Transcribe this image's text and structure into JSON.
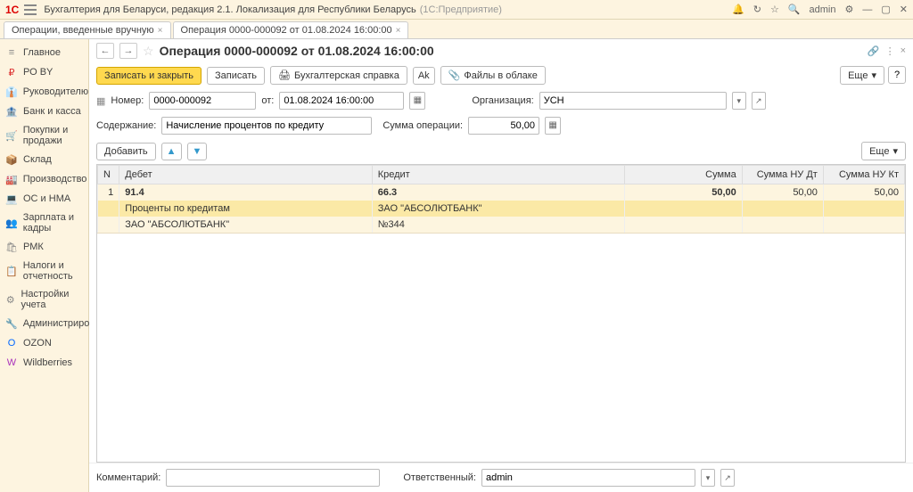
{
  "app": {
    "title": "Бухгалтерия для Беларуси, редакция 2.1. Локализация для Республики Беларусь",
    "sub": "(1С:Предприятие)",
    "user": "admin"
  },
  "tabs": [
    {
      "label": "Операции, введенные вручную"
    },
    {
      "label": "Операция 0000-000092 от 01.08.2024 16:00:00"
    }
  ],
  "nav": [
    {
      "icon": "≡",
      "label": "Главное",
      "c": "#888"
    },
    {
      "icon": "₽",
      "label": "РО BY",
      "c": "#d33"
    },
    {
      "icon": "👔",
      "label": "Руководителю",
      "c": "#888"
    },
    {
      "icon": "🏦",
      "label": "Банк и касса",
      "c": "#5a8"
    },
    {
      "icon": "🛒",
      "label": "Покупки и продажи",
      "c": "#5a8"
    },
    {
      "icon": "📦",
      "label": "Склад",
      "c": "#c80"
    },
    {
      "icon": "🏭",
      "label": "Производство",
      "c": "#888"
    },
    {
      "icon": "💻",
      "label": "ОС и НМА",
      "c": "#888"
    },
    {
      "icon": "👥",
      "label": "Зарплата и кадры",
      "c": "#39c"
    },
    {
      "icon": "🛍",
      "label": "РМК",
      "c": "#888"
    },
    {
      "icon": "📋",
      "label": "Налоги и отчетность",
      "c": "#888"
    },
    {
      "icon": "⚙",
      "label": "Настройки учета",
      "c": "#888"
    },
    {
      "icon": "🔧",
      "label": "Администрирование",
      "c": "#888"
    },
    {
      "icon": "O",
      "label": "OZON",
      "c": "#06f"
    },
    {
      "icon": "W",
      "label": "Wildberries",
      "c": "#a3b"
    }
  ],
  "doc": {
    "title": "Операция 0000-000092 от 01.08.2024 16:00:00",
    "btn_save_close": "Записать и закрыть",
    "btn_save": "Записать",
    "btn_ref": "Бухгалтерская справка",
    "btn_files": "Файлы в облаке",
    "more": "Еще",
    "lbl_number": "Номер:",
    "number": "0000-000092",
    "lbl_from": "от:",
    "date": "01.08.2024 16:00:00",
    "lbl_org": "Организация:",
    "org": "УСН",
    "lbl_content": "Содержание:",
    "content": "Начисление процентов по кредиту",
    "lbl_sum": "Сумма операции:",
    "sum": "50,00",
    "btn_add": "Добавить",
    "lbl_comment": "Комментарий:",
    "comment": "",
    "lbl_resp": "Ответственный:",
    "resp": "admin"
  },
  "cols": {
    "n": "N",
    "debit": "Дебет",
    "credit": "Кредит",
    "sum": "Сумма",
    "nud": "Сумма НУ Дт",
    "nuk": "Сумма НУ Кт"
  },
  "rows": [
    {
      "n": "1",
      "d": "91.4",
      "k": "66.3",
      "s": "50,00",
      "nd": "50,00",
      "nk": "50,00",
      "bold": true
    },
    {
      "n": "",
      "d": "Проценты по кредитам",
      "k": "ЗАО \"АБСОЛЮТБАНК\"",
      "s": "",
      "nd": "",
      "nk": "",
      "hl": true
    },
    {
      "n": "",
      "d": "ЗАО \"АБСОЛЮТБАНК\"",
      "k": "№344",
      "s": "",
      "nd": "",
      "nk": ""
    }
  ]
}
